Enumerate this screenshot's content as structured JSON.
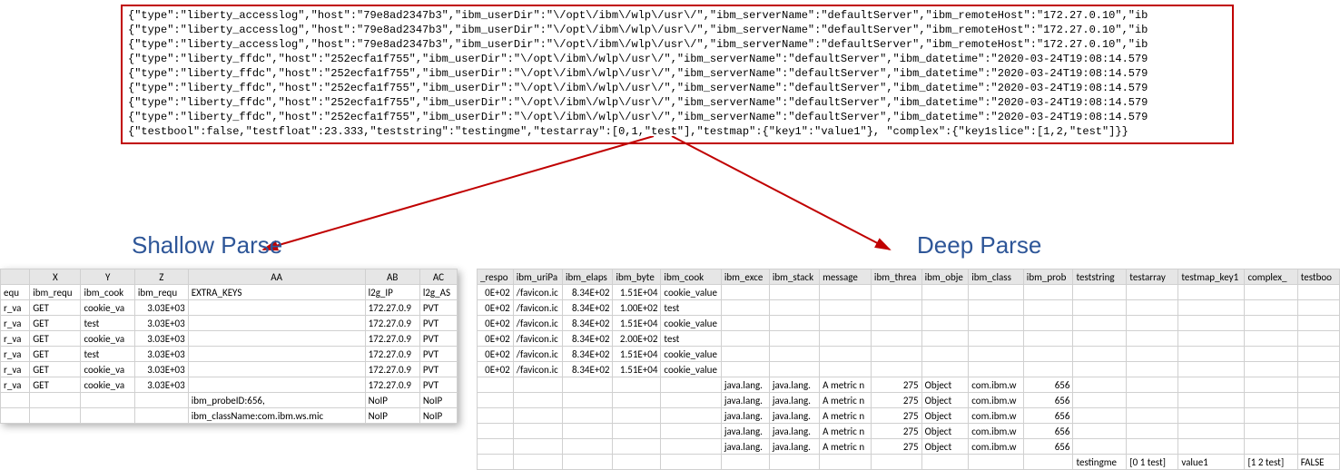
{
  "labels": {
    "shallow": "Shallow Parse",
    "deep": "Deep Parse"
  },
  "json_lines": [
    "{\"type\":\"liberty_accesslog\",\"host\":\"79e8ad2347b3\",\"ibm_userDir\":\"\\/opt\\/ibm\\/wlp\\/usr\\/\",\"ibm_serverName\":\"defaultServer\",\"ibm_remoteHost\":\"172.27.0.10\",\"ib",
    "{\"type\":\"liberty_accesslog\",\"host\":\"79e8ad2347b3\",\"ibm_userDir\":\"\\/opt\\/ibm\\/wlp\\/usr\\/\",\"ibm_serverName\":\"defaultServer\",\"ibm_remoteHost\":\"172.27.0.10\",\"ib",
    "{\"type\":\"liberty_accesslog\",\"host\":\"79e8ad2347b3\",\"ibm_userDir\":\"\\/opt\\/ibm\\/wlp\\/usr\\/\",\"ibm_serverName\":\"defaultServer\",\"ibm_remoteHost\":\"172.27.0.10\",\"ib",
    "{\"type\":\"liberty_ffdc\",\"host\":\"252ecfa1f755\",\"ibm_userDir\":\"\\/opt\\/ibm\\/wlp\\/usr\\/\",\"ibm_serverName\":\"defaultServer\",\"ibm_datetime\":\"2020-03-24T19:08:14.579",
    "{\"type\":\"liberty_ffdc\",\"host\":\"252ecfa1f755\",\"ibm_userDir\":\"\\/opt\\/ibm\\/wlp\\/usr\\/\",\"ibm_serverName\":\"defaultServer\",\"ibm_datetime\":\"2020-03-24T19:08:14.579",
    "{\"type\":\"liberty_ffdc\",\"host\":\"252ecfa1f755\",\"ibm_userDir\":\"\\/opt\\/ibm\\/wlp\\/usr\\/\",\"ibm_serverName\":\"defaultServer\",\"ibm_datetime\":\"2020-03-24T19:08:14.579",
    "{\"type\":\"liberty_ffdc\",\"host\":\"252ecfa1f755\",\"ibm_userDir\":\"\\/opt\\/ibm\\/wlp\\/usr\\/\",\"ibm_serverName\":\"defaultServer\",\"ibm_datetime\":\"2020-03-24T19:08:14.579",
    "{\"type\":\"liberty_ffdc\",\"host\":\"252ecfa1f755\",\"ibm_userDir\":\"\\/opt\\/ibm\\/wlp\\/usr\\/\",\"ibm_serverName\":\"defaultServer\",\"ibm_datetime\":\"2020-03-24T19:08:14.579",
    "{\"testbool\":false,\"testfloat\":23.333,\"teststring\":\"testingme\",\"testarray\":[0,1,\"test\"],\"testmap\":{\"key1\":\"value1\"}, \"complex\":{\"key1slice\":[1,2,\"test\"]}}"
  ],
  "left_sheet": {
    "col_letters": [
      "",
      "X",
      "Y",
      "Z",
      "AA",
      "AB",
      "AC"
    ],
    "headers": [
      "equ",
      "ibm_requ",
      "ibm_cook",
      "ibm_requ",
      "EXTRA_KEYS",
      "l2g_IP",
      "l2g_AS"
    ],
    "rows": [
      [
        "r_va",
        "GET",
        "cookie_va",
        "3.03E+03",
        "",
        "172.27.0.9",
        "PVT"
      ],
      [
        "r_va",
        "GET",
        "test",
        "3.03E+03",
        "",
        "172.27.0.9",
        "PVT"
      ],
      [
        "r_va",
        "GET",
        "cookie_va",
        "3.03E+03",
        "",
        "172.27.0.9",
        "PVT"
      ],
      [
        "r_va",
        "GET",
        "test",
        "3.03E+03",
        "",
        "172.27.0.9",
        "PVT"
      ],
      [
        "r_va",
        "GET",
        "cookie_va",
        "3.03E+03",
        "",
        "172.27.0.9",
        "PVT"
      ],
      [
        "r_va",
        "GET",
        "cookie_va",
        "3.03E+03",
        "",
        "172.27.0.9",
        "PVT"
      ],
      [
        "",
        "",
        "",
        "",
        "ibm_probeID:656,",
        "NoIP",
        "NoIP"
      ],
      [
        "",
        "",
        "",
        "",
        "ibm_className:com.ibm.ws.mic",
        "NoIP",
        "NoIP"
      ]
    ]
  },
  "right_sheet": {
    "headers": [
      "_respo",
      "ibm_uriPa",
      "ibm_elaps",
      "ibm_byte",
      "ibm_cook",
      "ibm_exce",
      "ibm_stack",
      "message",
      "ibm_threa",
      "ibm_obje",
      "ibm_class",
      "ibm_prob",
      "teststring",
      "testarray",
      "testmap_key1",
      "complex_",
      "testboo"
    ],
    "rows": [
      [
        "0E+02",
        "/favicon.ic",
        "8.34E+02",
        "1.51E+04",
        "cookie_value",
        "",
        "",
        "",
        "",
        "",
        "",
        "",
        "",
        "",
        "",
        "",
        ""
      ],
      [
        "0E+02",
        "/favicon.ic",
        "8.34E+02",
        "1.00E+02",
        "test",
        "",
        "",
        "",
        "",
        "",
        "",
        "",
        "",
        "",
        "",
        "",
        ""
      ],
      [
        "0E+02",
        "/favicon.ic",
        "8.34E+02",
        "1.51E+04",
        "cookie_value",
        "",
        "",
        "",
        "",
        "",
        "",
        "",
        "",
        "",
        "",
        "",
        ""
      ],
      [
        "0E+02",
        "/favicon.ic",
        "8.34E+02",
        "2.00E+02",
        "test",
        "",
        "",
        "",
        "",
        "",
        "",
        "",
        "",
        "",
        "",
        "",
        ""
      ],
      [
        "0E+02",
        "/favicon.ic",
        "8.34E+02",
        "1.51E+04",
        "cookie_value",
        "",
        "",
        "",
        "",
        "",
        "",
        "",
        "",
        "",
        "",
        "",
        ""
      ],
      [
        "0E+02",
        "/favicon.ic",
        "8.34E+02",
        "1.51E+04",
        "cookie_value",
        "",
        "",
        "",
        "",
        "",
        "",
        "",
        "",
        "",
        "",
        "",
        ""
      ],
      [
        "",
        "",
        "",
        "",
        "",
        "java.lang.",
        "java.lang.",
        "A metric n",
        "275",
        "Object",
        "com.ibm.w",
        "656",
        "",
        "",
        "",
        "",
        ""
      ],
      [
        "",
        "",
        "",
        "",
        "",
        "java.lang.",
        "java.lang.",
        "A metric n",
        "275",
        "Object",
        "com.ibm.w",
        "656",
        "",
        "",
        "",
        "",
        ""
      ],
      [
        "",
        "",
        "",
        "",
        "",
        "java.lang.",
        "java.lang.",
        "A metric n",
        "275",
        "Object",
        "com.ibm.w",
        "656",
        "",
        "",
        "",
        "",
        ""
      ],
      [
        "",
        "",
        "",
        "",
        "",
        "java.lang.",
        "java.lang.",
        "A metric n",
        "275",
        "Object",
        "com.ibm.w",
        "656",
        "",
        "",
        "",
        "",
        ""
      ],
      [
        "",
        "",
        "",
        "",
        "",
        "java.lang.",
        "java.lang.",
        "A metric n",
        "275",
        "Object",
        "com.ibm.w",
        "656",
        "",
        "",
        "",
        "",
        ""
      ],
      [
        "",
        "",
        "",
        "",
        "",
        "",
        "",
        "",
        "",
        "",
        "",
        "",
        "testingme",
        "[0 1 test]",
        "value1",
        "[1 2 test]",
        "FALSE"
      ]
    ]
  }
}
